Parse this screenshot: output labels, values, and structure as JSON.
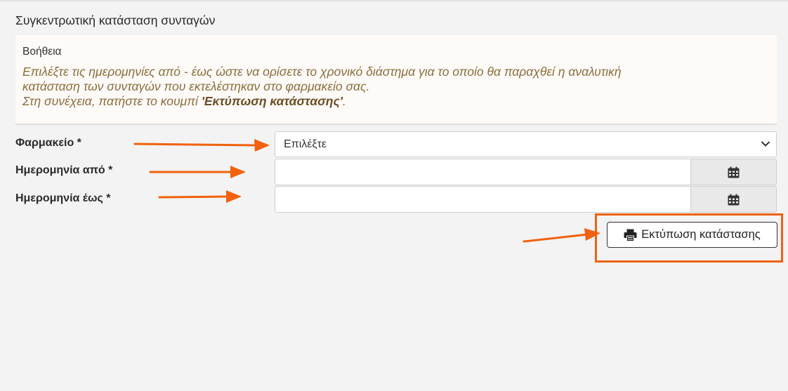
{
  "page": {
    "title": "Συγκεντρωτική κατάσταση συνταγών"
  },
  "help": {
    "title": "Βοήθεια",
    "line1": "Επιλέξτε τις ημερομηνίες από - έως ώστε να ορίσετε το χρονικό διάστημα για το οποίο θα παραχθεί η αναλυτική",
    "line2": "κατάσταση των συνταγών που εκτελέστηκαν στο φαρμακείο σας.",
    "line3_prefix": "Στη συνέχεια, πατήστε το κουμπί ",
    "line3_bold": "'Εκτύπωση κατάστασης'",
    "line3_suffix": "."
  },
  "form": {
    "pharmacy": {
      "label": "Φαρμακείο *",
      "selected": "Επιλέξτε"
    },
    "date_from": {
      "label": "Ημερομηνία από *",
      "value": ""
    },
    "date_to": {
      "label": "Ημερομηνία έως *",
      "value": ""
    },
    "print_button": {
      "label": "Εκτύπωση κατάστασης"
    }
  },
  "icons": {
    "calendar": "calendar-icon",
    "chevron": "chevron-down-icon",
    "printer": "printer-icon"
  },
  "colors": {
    "annotation": "#f0620e",
    "help_text": "#8b6d3b",
    "help_background": "#fefaf8",
    "page_background": "#f3f3f3"
  }
}
